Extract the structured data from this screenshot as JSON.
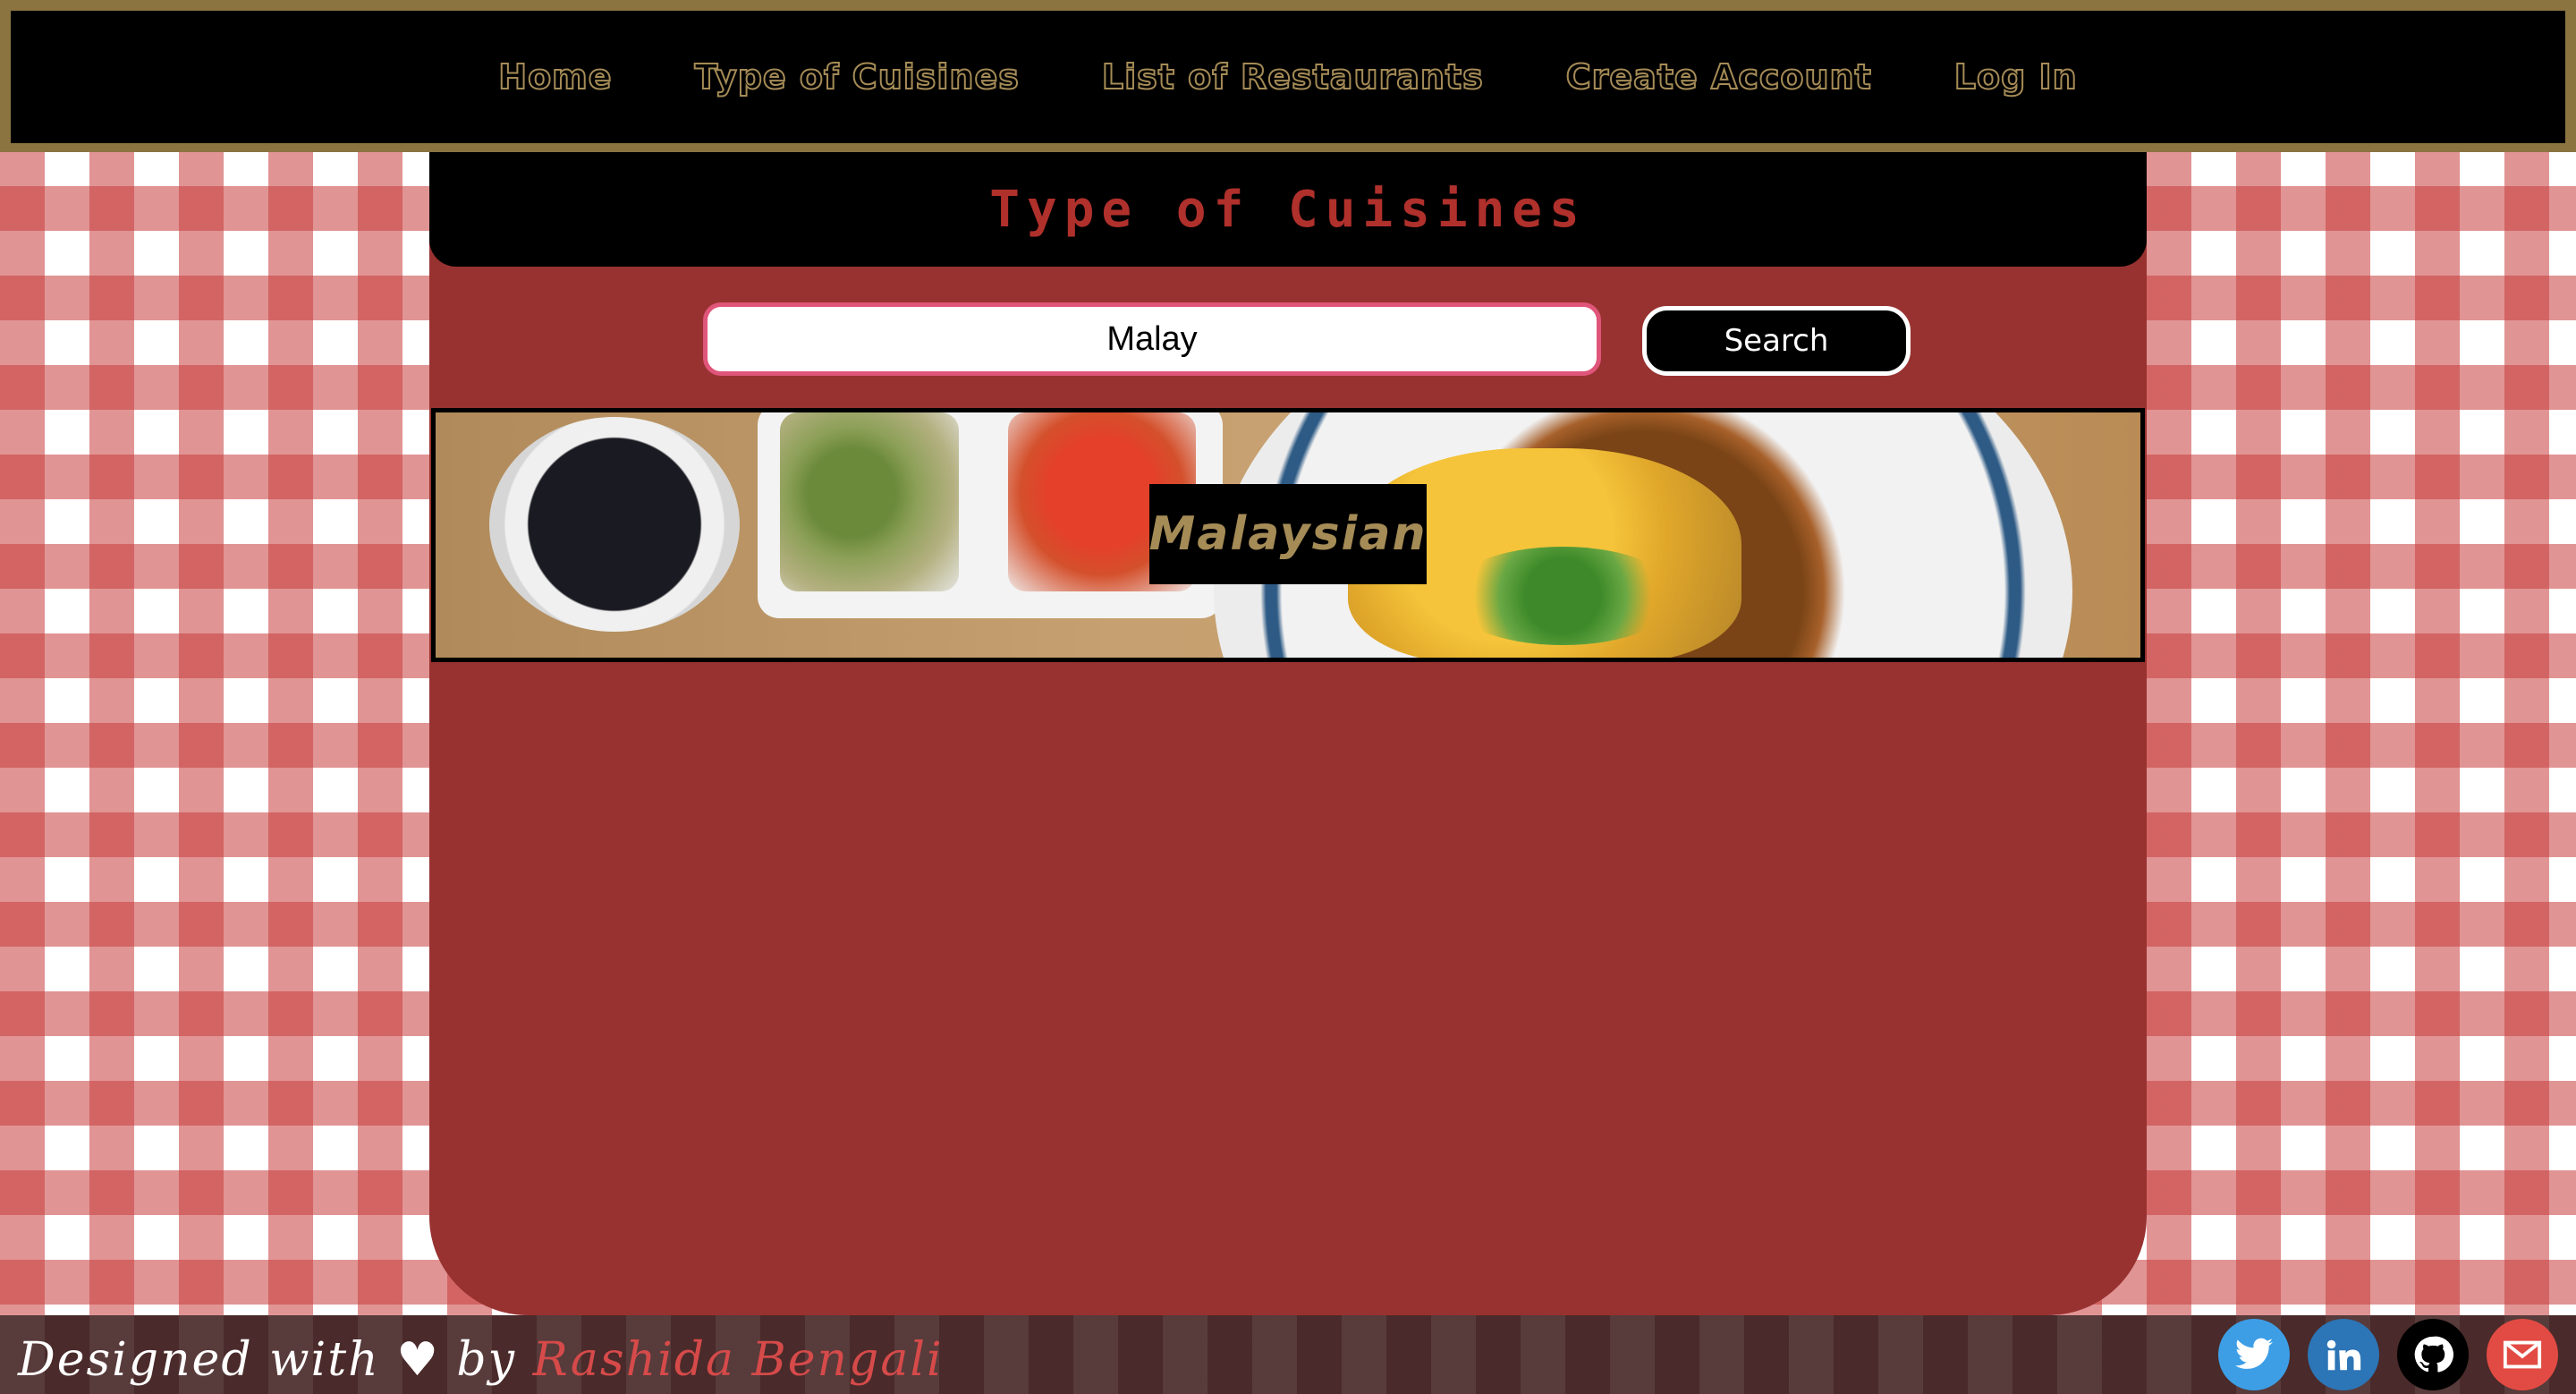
{
  "nav": {
    "items": [
      {
        "label": "Home"
      },
      {
        "label": "Type of Cuisines"
      },
      {
        "label": "List of Restaurants"
      },
      {
        "label": "Create Account"
      },
      {
        "label": "Log In"
      }
    ]
  },
  "page": {
    "title": "Type of Cuisines"
  },
  "search": {
    "value": "Malay",
    "button_label": "Search"
  },
  "results": [
    {
      "name": "Malaysian"
    }
  ],
  "footer": {
    "credit_prefix": "Designed with",
    "heart": "♥",
    "credit_by": "by",
    "author": "Rashida Bengali",
    "social": [
      {
        "name": "twitter",
        "color": "#3d9ee6"
      },
      {
        "name": "linkedin",
        "color": "#2c75b6"
      },
      {
        "name": "github",
        "color": "#000000"
      },
      {
        "name": "email",
        "color": "#e24b43"
      }
    ]
  },
  "colors": {
    "nav_background": "#000000",
    "nav_border": "#8b7440",
    "nav_text": "#a58b56",
    "panel": "#983230",
    "title_text": "#b0302c",
    "search_border": "#e0557a"
  }
}
